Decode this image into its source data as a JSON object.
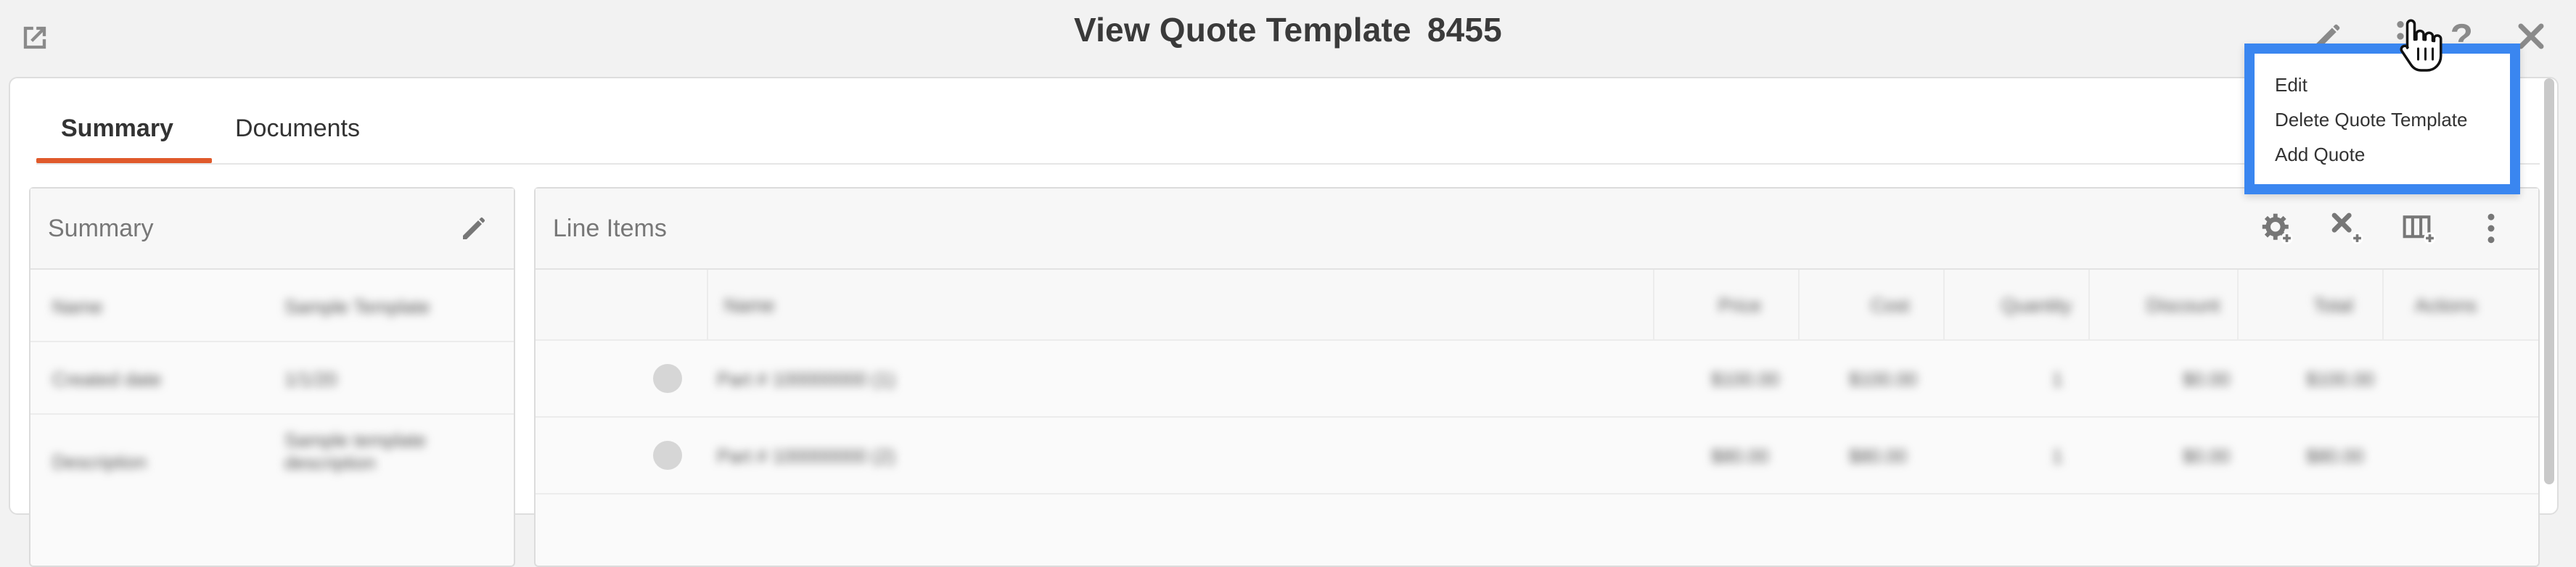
{
  "window": {
    "title_prefix": "View Quote Template",
    "title_number": "8455"
  },
  "tabs": [
    {
      "label": "Summary",
      "active": true
    },
    {
      "label": "Documents",
      "active": false
    }
  ],
  "summary_panel": {
    "title": "Summary",
    "rows": [
      {
        "label": "Name",
        "value": "Sample Template"
      },
      {
        "label": "Created date",
        "value": "1/1/20"
      },
      {
        "label": "Description",
        "value": "Sample template description"
      }
    ]
  },
  "line_items_panel": {
    "title": "Line Items",
    "columns": [
      "Name",
      "Price",
      "Cost",
      "Quantity",
      "Discount",
      "Total",
      "Actions"
    ],
    "rows": [
      {
        "name": "Part # 100000000 (1)",
        "price": "$100.00",
        "cost": "$100.00",
        "quantity": "1",
        "discount": "$0.00",
        "total": "$100.00"
      },
      {
        "name": "Part # 100000000 (2)",
        "price": "$80.00",
        "cost": "$80.00",
        "quantity": "1",
        "discount": "$0.00",
        "total": "$80.00"
      }
    ]
  },
  "action_menu": {
    "items": [
      "Edit",
      "Delete Quote Template",
      "Add Quote"
    ]
  },
  "colors": {
    "accent": "#e05a2b",
    "highlight": "#3a86f0"
  },
  "icons": {
    "popout": "external-link-icon",
    "edit": "pencil-icon",
    "more": "vertical-dots-icon",
    "help": "question-mark-icon",
    "close": "close-icon",
    "li_settings": "gear-plus-icon",
    "li_tools": "tools-plus-icon",
    "li_columns": "columns-plus-icon",
    "li_more": "vertical-dots-icon"
  }
}
